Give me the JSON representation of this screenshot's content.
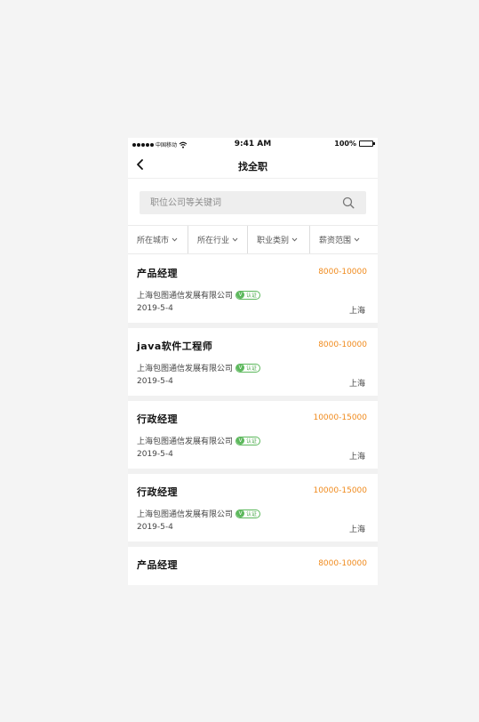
{
  "status_bar": {
    "carrier": "中国移动",
    "time": "9:41 AM",
    "battery": "100%"
  },
  "nav": {
    "title": "找全职"
  },
  "search": {
    "placeholder": "职位公司等关键词"
  },
  "filters": [
    {
      "label": "所在城市"
    },
    {
      "label": "所在行业"
    },
    {
      "label": "职业类别"
    },
    {
      "label": "薪资范围"
    }
  ],
  "badge_label": "认证",
  "jobs": [
    {
      "title": "产品经理",
      "salary": "8000-10000",
      "company": "上海包图通信发展有限公司",
      "date": "2019-5-4",
      "city": "上海"
    },
    {
      "title": "java软件工程师",
      "salary": "8000-10000",
      "company": "上海包图通信发展有限公司",
      "date": "2019-5-4",
      "city": "上海"
    },
    {
      "title": "行政经理",
      "salary": "10000-15000",
      "company": "上海包图通信发展有限公司",
      "date": "2019-5-4",
      "city": "上海"
    },
    {
      "title": "行政经理",
      "salary": "10000-15000",
      "company": "上海包图通信发展有限公司",
      "date": "2019-5-4",
      "city": "上海"
    },
    {
      "title": "产品经理",
      "salary": "8000-10000"
    }
  ],
  "colors": {
    "salary": "#f08a1c",
    "badge": "#5cb85c",
    "background": "#f4f4f4"
  },
  "icons": {
    "back": "chevron-left-icon",
    "search": "search-icon",
    "dropdown": "chevron-down-icon",
    "verified": "verified-badge-icon"
  }
}
